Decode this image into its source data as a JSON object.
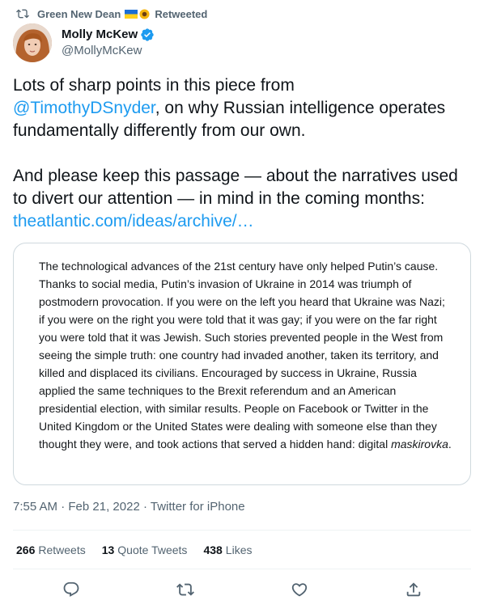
{
  "retweet_banner": {
    "retweeter": "Green New Dean",
    "action": "Retweeted"
  },
  "author": {
    "display_name": "Molly McKew",
    "handle": "@MollyMcKew",
    "verified": true
  },
  "tweet": {
    "line1_before": "Lots of sharp points in this piece from",
    "mention": "@TimothyDSnyder",
    "line1_after": ", on why Russian intelligence operates fundamentally differently from our own.",
    "paragraph2": "And please keep this passage — about the narratives used to divert our attention — in mind in the coming months:",
    "link_text": "theatlantic.com/ideas/archive/…"
  },
  "quote_image": {
    "text_main": "The technological advances of the 21st century have only helped Putin’s cause. Thanks to social media, Putin’s invasion of Ukraine in 2014 was triumph of postmodern provocation. If you were on the left you heard that Ukraine was Nazi; if you were on the right you were told that it was gay; if you were on the far right you were told that it was Jewish. Such stories prevented people in the West from seeing the simple truth: one country had invaded another, taken its territory, and killed and displaced its civilians. Encouraged by success in Ukraine, Russia applied the same techniques to the Brexit referendum and an American presidential election, with similar results. People on Facebook or Twitter in the United Kingdom or the United States were dealing with someone else than they thought they were, and took actions that served a hidden hand: digital",
    "text_italic": "maskirovka",
    "text_end": "."
  },
  "meta": {
    "time": "7:55 AM",
    "separator": "·",
    "date": "Feb 21, 2022",
    "client": "Twitter for iPhone"
  },
  "stats": {
    "retweets_count": "266",
    "retweets_label": "Retweets",
    "quotes_count": "13",
    "quotes_label": "Quote Tweets",
    "likes_count": "438",
    "likes_label": "Likes"
  },
  "icons": {
    "retweet": "retweet-icon",
    "verified": "verified-badge-icon",
    "reply": "reply-icon",
    "share": "share-icon",
    "like": "heart-icon"
  },
  "colors": {
    "link": "#1d9bf0",
    "secondary_text": "#536471",
    "primary_text": "#0f1419",
    "border": "#cfd9de"
  }
}
